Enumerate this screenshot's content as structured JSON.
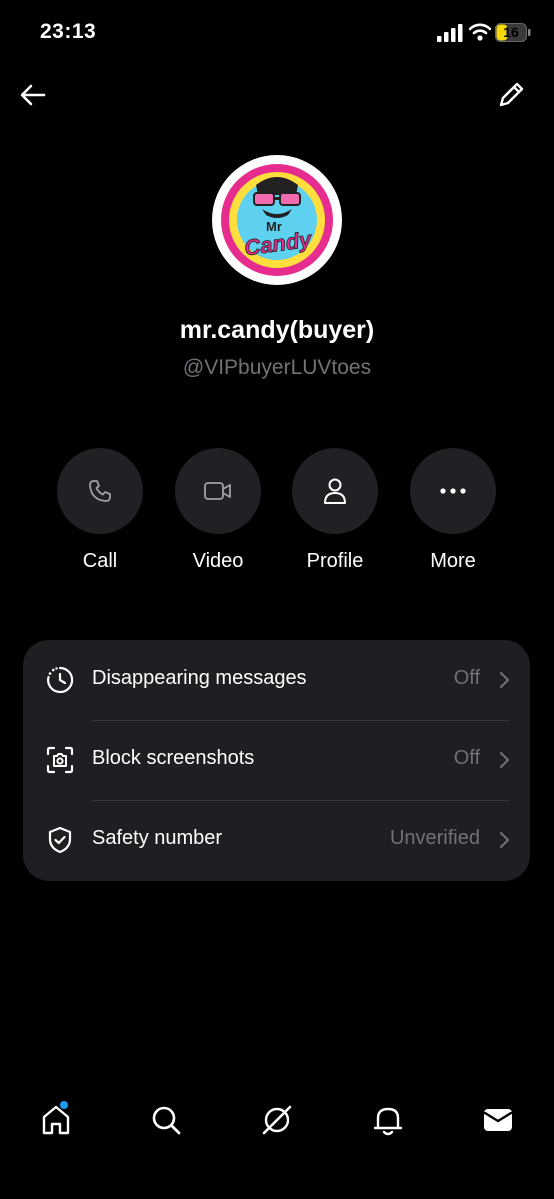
{
  "status_bar": {
    "time": "23:13",
    "battery_level": "16",
    "icons": [
      "signal-icon",
      "wifi-icon",
      "battery-icon"
    ]
  },
  "nav": {
    "back_icon": "arrow-left-icon",
    "edit_icon": "pencil-icon"
  },
  "profile": {
    "name": "mr.candy(buyer)",
    "handle": "@VIPbuyerLUVtoes",
    "avatar_text_top": "Mr",
    "avatar_text_bottom": "Candy"
  },
  "actions": [
    {
      "label": "Call",
      "icon": "phone-icon"
    },
    {
      "label": "Video",
      "icon": "video-camera-icon"
    },
    {
      "label": "Profile",
      "icon": "person-icon"
    },
    {
      "label": "More",
      "icon": "more-dots-icon"
    }
  ],
  "settings": [
    {
      "label": "Disappearing messages",
      "value": "Off",
      "icon": "timer-icon"
    },
    {
      "label": "Block screenshots",
      "value": "Off",
      "icon": "screenshot-camera-icon"
    },
    {
      "label": "Safety number",
      "value": "Unverified",
      "icon": "shield-check-icon"
    }
  ],
  "tab_bar": {
    "tabs": [
      "home-icon",
      "search-icon",
      "grok-icon",
      "bell-icon",
      "mail-icon"
    ],
    "home_has_notification": true
  },
  "colors": {
    "background": "#000000",
    "card": "#1d1f22",
    "action_circle": "#1f2124",
    "muted_text": "#6f7378",
    "accent": "#1d9bf0",
    "battery": "#f5d90a"
  }
}
